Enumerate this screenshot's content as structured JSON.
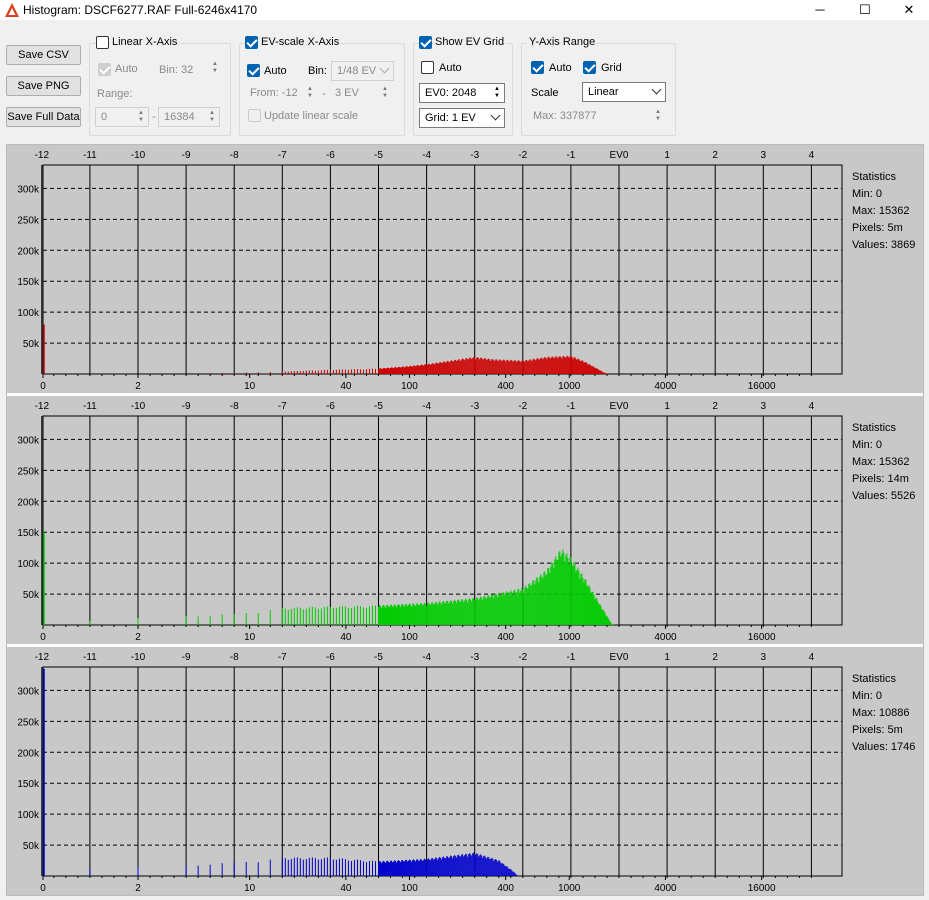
{
  "window": {
    "title": "Histogram: DSCF6277.RAF Full-6246x4170",
    "minimize_glyph": "─",
    "maximize_glyph": "☐",
    "close_glyph": "✕"
  },
  "buttons": {
    "save_csv": "Save CSV",
    "save_png": "Save PNG",
    "save_full_data": "Save Full Data"
  },
  "linear_x_axis": {
    "title": "Linear X-Axis",
    "checked": false,
    "auto_label": "Auto",
    "auto_checked": true,
    "bin_label": "Bin: 32",
    "range_label": "Range:",
    "range_from": "0",
    "range_sep": "-",
    "range_to": "16384"
  },
  "ev_scale_x_axis": {
    "title": "EV-scale X-Axis",
    "checked": true,
    "auto_label": "Auto",
    "auto_checked": true,
    "bin_label": "Bin:",
    "bin_value": "1/48 EV",
    "from_label": "From: -12",
    "range_sep": "-",
    "to_value": "3 EV",
    "update_label": "Update linear scale",
    "update_checked": false
  },
  "show_ev_grid": {
    "title": "Show EV Grid",
    "checked": true,
    "auto_label": "Auto",
    "auto_checked": false,
    "ev0_value": "EV0: 2048",
    "grid_value": "Grid: 1 EV"
  },
  "y_axis_range": {
    "title": "Y-Axis Range",
    "auto_label": "Auto",
    "auto_checked": true,
    "grid_label": "Grid",
    "grid_checked": true,
    "scale_label": "Scale",
    "scale_value": "Linear",
    "max_value": "Max: 337877"
  },
  "axes": {
    "ev_ticks": [
      "-12",
      "-11",
      "-10",
      "-9",
      "-8",
      "-7",
      "-6",
      "-5",
      "-4",
      "-3",
      "-2",
      "-1",
      "EV0",
      "1",
      "2",
      "3",
      "4"
    ],
    "linear_ticks": [
      "0",
      "2",
      "10",
      "40",
      "100",
      "400",
      "1000",
      "4000",
      "16000"
    ],
    "y_ticks": [
      "50k",
      "100k",
      "150k",
      "200k",
      "250k",
      "300k"
    ]
  },
  "colors": {
    "red": "#cc0000",
    "green": "#00cc00",
    "blue": "#0000cc",
    "plot_bg": "#c8c8c8",
    "grid": "#000000"
  },
  "stats_title": "Statistics",
  "channels": [
    {
      "name": "red",
      "color": "#cc0000",
      "stats": {
        "min": "Min: 0",
        "max": "Max: 15362",
        "pixels": "Pixels: 5m",
        "values": "Values: 3869"
      },
      "spike_at_zero": 80000,
      "profile_ev": [
        [
          -8.5,
          1500
        ],
        [
          -7,
          4000
        ],
        [
          -6,
          7000
        ],
        [
          -5,
          9000
        ],
        [
          -4.5,
          12000
        ],
        [
          -4,
          16000
        ],
        [
          -3.5,
          22000
        ],
        [
          -3,
          28000
        ],
        [
          -2.6,
          24000
        ],
        [
          -2,
          22000
        ],
        [
          -1.5,
          28000
        ],
        [
          -1,
          30000
        ],
        [
          -0.7,
          20000
        ],
        [
          -0.3,
          2000
        ],
        [
          -0.2,
          0
        ]
      ]
    },
    {
      "name": "green",
      "color": "#00cc00",
      "stats": {
        "min": "Min: 0",
        "max": "Max: 15362",
        "pixels": "Pixels: 14m",
        "values": "Values: 5526"
      },
      "spike_at_zero": 150000,
      "profile_ev": [
        [
          -11,
          8000
        ],
        [
          -10,
          12000
        ],
        [
          -9,
          15000
        ],
        [
          -8,
          18000
        ],
        [
          -7,
          28000
        ],
        [
          -6,
          30000
        ],
        [
          -5,
          32000
        ],
        [
          -4,
          36000
        ],
        [
          -3,
          44000
        ],
        [
          -2,
          60000
        ],
        [
          -1.5,
          90000
        ],
        [
          -1.2,
          125000
        ],
        [
          -1,
          110000
        ],
        [
          -0.7,
          75000
        ],
        [
          -0.4,
          35000
        ],
        [
          -0.15,
          2000
        ],
        [
          -0.1,
          0
        ]
      ]
    },
    {
      "name": "blue",
      "color": "#0000cc",
      "stats": {
        "min": "Min: 0",
        "max": "Max: 10886",
        "pixels": "Pixels: 5m",
        "values": "Values: 1746"
      },
      "spike_at_zero": 335000,
      "profile_ev": [
        [
          -11,
          12000
        ],
        [
          -10,
          15000
        ],
        [
          -9,
          18000
        ],
        [
          -8,
          22000
        ],
        [
          -7,
          30000
        ],
        [
          -6,
          30000
        ],
        [
          -5,
          24000
        ],
        [
          -4,
          28000
        ],
        [
          -3,
          38000
        ],
        [
          -2.5,
          26000
        ],
        [
          -2.2,
          8000
        ],
        [
          -2.1,
          0
        ]
      ]
    }
  ]
}
